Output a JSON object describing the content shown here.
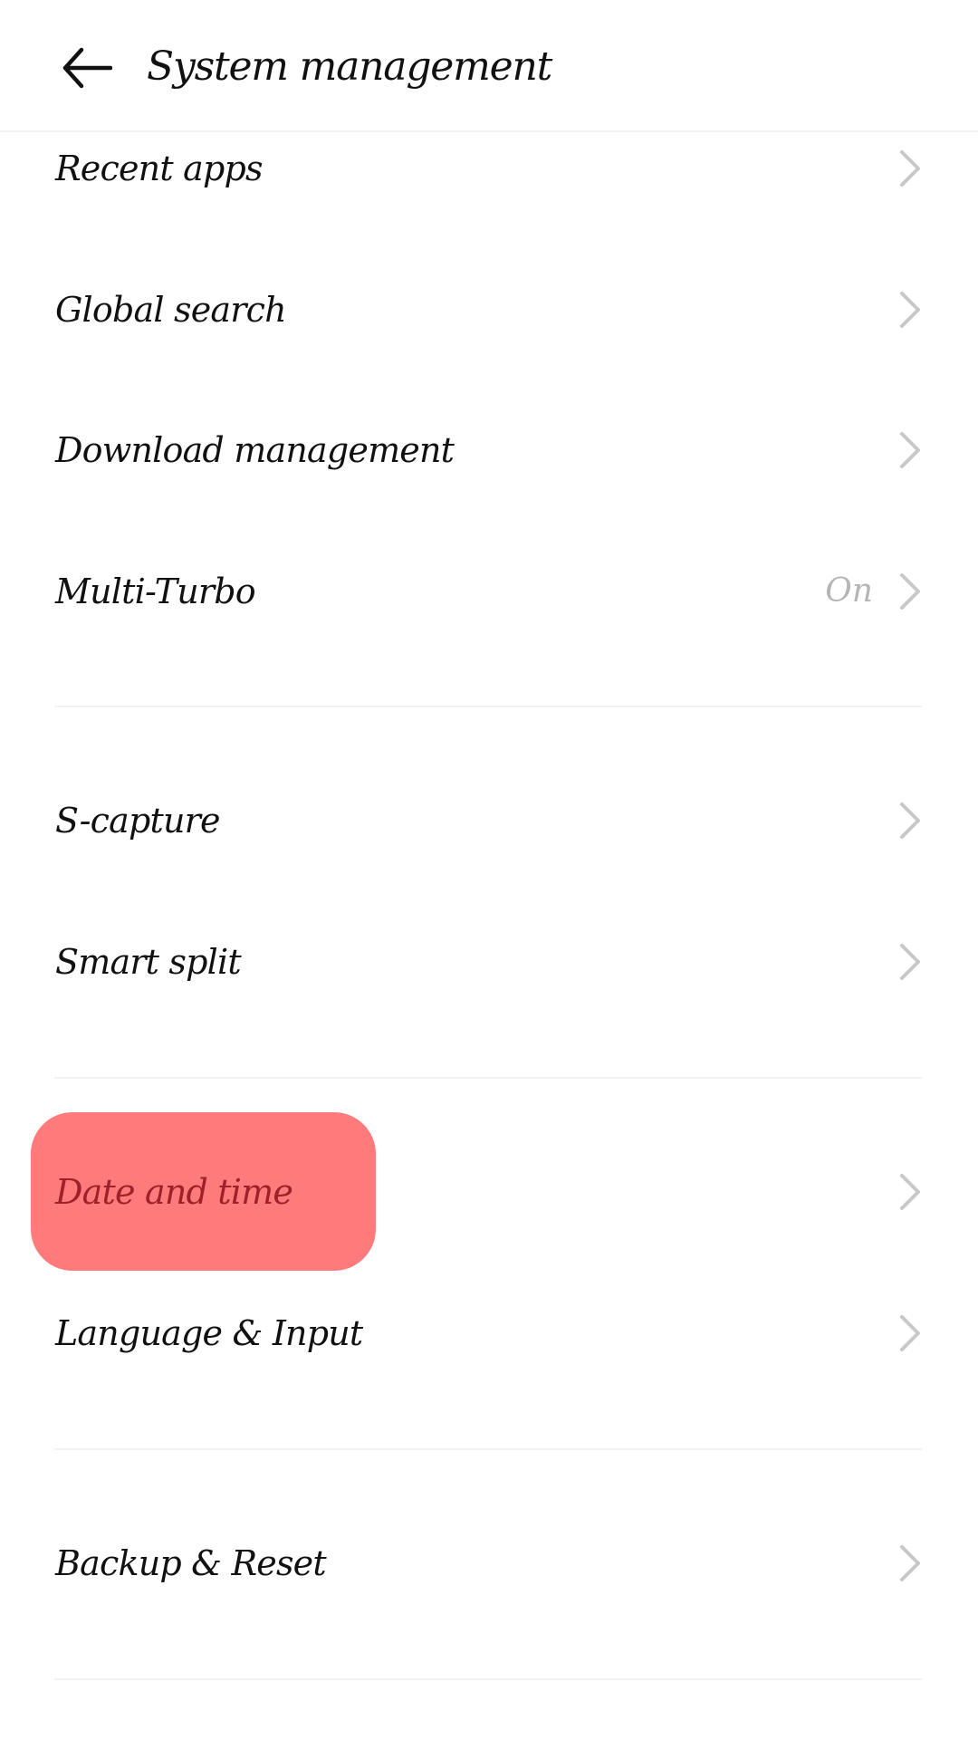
{
  "header": {
    "title": "System management",
    "back_icon": "arrow-left-icon"
  },
  "colors": {
    "background": "#ffffff",
    "text": "#111111",
    "secondary_text": "#b5b5b5",
    "chevron": "#c8c8c8",
    "divider": "#f2f2f2",
    "highlight": "#ff7b7b",
    "highlight_text": "#9e2028"
  },
  "sections": [
    {
      "items": [
        {
          "label": "Recent apps",
          "value": null,
          "icon": "chevron-right-icon"
        },
        {
          "label": "Global search",
          "value": null,
          "icon": "chevron-right-icon"
        },
        {
          "label": "Download management",
          "value": null,
          "icon": "chevron-right-icon"
        },
        {
          "label": "Multi-Turbo",
          "value": "On",
          "icon": "chevron-right-icon"
        }
      ]
    },
    {
      "items": [
        {
          "label": "S-capture",
          "value": null,
          "icon": "chevron-right-icon"
        },
        {
          "label": "Smart split",
          "value": null,
          "icon": "chevron-right-icon"
        }
      ]
    },
    {
      "items": [
        {
          "label": "Date and time",
          "value": null,
          "icon": "chevron-right-icon",
          "highlighted": true
        },
        {
          "label": "Language & Input",
          "value": null,
          "icon": "chevron-right-icon"
        }
      ]
    },
    {
      "items": [
        {
          "label": "Backup & Reset",
          "value": null,
          "icon": "chevron-right-icon"
        }
      ]
    }
  ]
}
